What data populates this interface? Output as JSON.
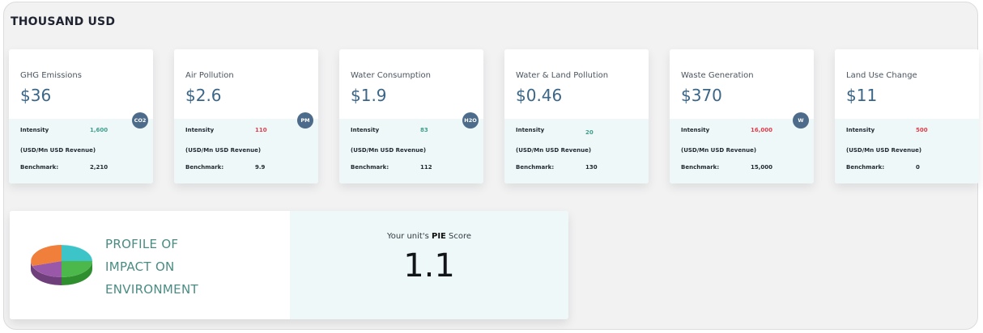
{
  "header": {
    "title": "THOUSAND USD"
  },
  "colors": {
    "positive": "#3f9f8c",
    "negative": "#e23c4b",
    "value": "#3b6687",
    "badge": "#4d6b8a",
    "panel_tint": "#eef8f8"
  },
  "labels": {
    "intensity": "Intensity",
    "unit": "(USD/Mn USD Revenue)",
    "benchmark": "Benchmark:"
  },
  "cards": [
    {
      "title": "GHG Emissions",
      "value": "$36",
      "badge": "CO2",
      "intensity": "1,600",
      "intensity_status": "positive",
      "benchmark": "2,210"
    },
    {
      "title": "Air Pollution",
      "value": "$2.6",
      "badge": "PM",
      "intensity": "110",
      "intensity_status": "negative",
      "benchmark": "9.9"
    },
    {
      "title": "Water Consumption",
      "value": "$1.9",
      "badge": "H2O",
      "intensity": "83",
      "intensity_status": "positive",
      "benchmark": "112"
    },
    {
      "title": "Water & Land Pollution",
      "value": "$0.46",
      "badge": "",
      "intensity": "20",
      "intensity_status": "positive",
      "benchmark": "130"
    },
    {
      "title": "Waste Generation",
      "value": "$370",
      "badge": "W",
      "intensity": "16,000",
      "intensity_status": "negative",
      "benchmark": "15,000"
    },
    {
      "title": "Land Use Change",
      "value": "$11",
      "badge": "",
      "intensity": "500",
      "intensity_status": "negative",
      "benchmark": "0"
    }
  ],
  "pie": {
    "lines": [
      "PROFILE OF",
      "IMPACT ON",
      "ENVIRONMENT"
    ],
    "icon": "pie-chart-3d-icon",
    "score_prefix": "Your unit's ",
    "score_bold": "PIE",
    "score_suffix": " Score",
    "score_value": "1.1"
  }
}
